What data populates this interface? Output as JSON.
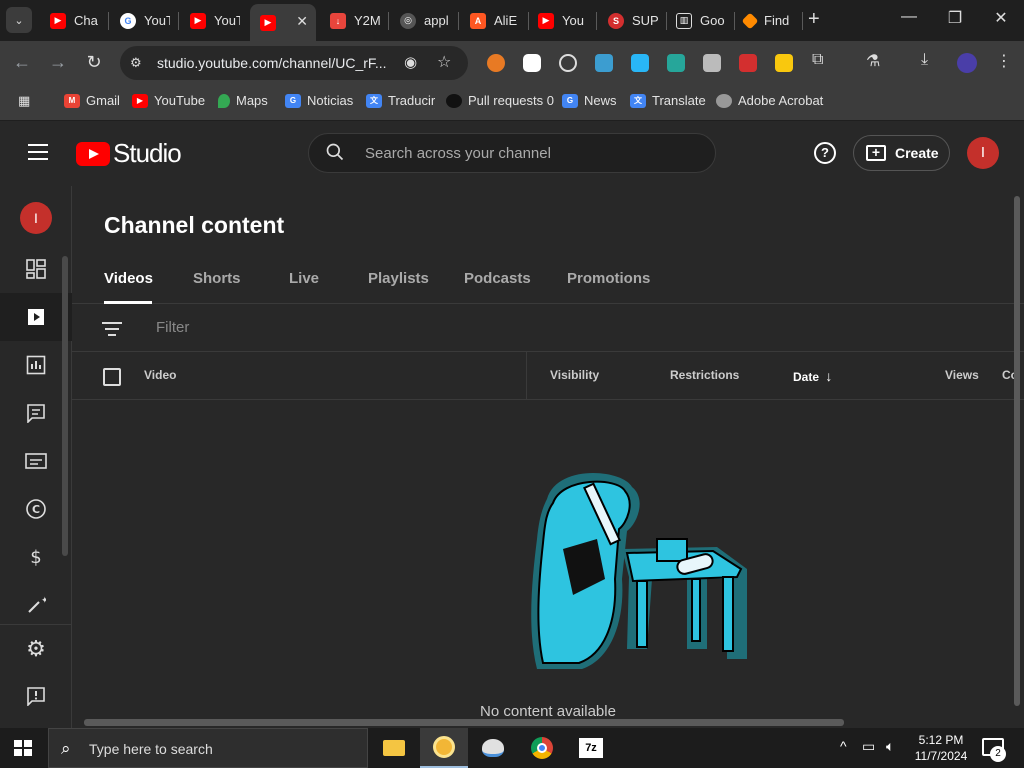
{
  "browser": {
    "tabs": [
      {
        "title": "Cha",
        "color": "#ff0000",
        "icon": "youtube-icon"
      },
      {
        "title": "YouT",
        "color": "#4285f4",
        "icon": "google-icon"
      },
      {
        "title": "YouT",
        "color": "#ff0000",
        "icon": "youtube-icon"
      },
      {
        "title": "",
        "color": "#ff0000",
        "icon": "youtube-studio-icon"
      },
      {
        "title": "Y2M",
        "color": "#e8453c",
        "icon": "download-icon"
      },
      {
        "title": "appl",
        "color": "#888888",
        "icon": "globe-icon"
      },
      {
        "title": "AliE",
        "color": "#ff5722",
        "icon": "aliexpress-icon"
      },
      {
        "title": "You",
        "color": "#ff0000",
        "icon": "youtube-icon"
      },
      {
        "title": "SUP",
        "color": "#d32f2f",
        "icon": "sup-icon"
      },
      {
        "title": "Goo",
        "color": "#dddddd",
        "icon": "google-docs-icon"
      },
      {
        "title": "Find",
        "color": "#ff8a00",
        "icon": "find-icon"
      }
    ],
    "new_tab": "+",
    "url": "studio.youtube.com/channel/UC_rF...",
    "bookmarks": [
      {
        "label": "Gmail",
        "color": "#ea4335"
      },
      {
        "label": "YouTube",
        "color": "#ff0000"
      },
      {
        "label": "Maps",
        "color": "#34a853"
      },
      {
        "label": "Noticias",
        "color": "#4285f4"
      },
      {
        "label": "Traducir",
        "color": "#4285f4"
      },
      {
        "label": "Pull requests 0",
        "color": "#333333"
      },
      {
        "label": "News",
        "color": "#4285f4"
      },
      {
        "label": "Translate",
        "color": "#4285f4"
      },
      {
        "label": "Adobe Acrobat",
        "color": "#888888"
      }
    ]
  },
  "studio": {
    "logo_text": "Studio",
    "search_placeholder": "Search across your channel",
    "create_label": "Create",
    "avatar_letter": "I",
    "help_glyph": "?"
  },
  "content": {
    "page_title": "Channel content",
    "tabs": [
      "Videos",
      "Shorts",
      "Live",
      "Playlists",
      "Podcasts",
      "Promotions"
    ],
    "filter_placeholder": "Filter",
    "columns": {
      "video": "Video",
      "visibility": "Visibility",
      "restrictions": "Restrictions",
      "date": "Date",
      "date_sort": "↓",
      "views": "Views",
      "comments": "Co"
    },
    "empty_text": "No content available"
  },
  "taskbar": {
    "search_text": "Type here to search",
    "time": "5:12 PM",
    "date": "11/7/2024",
    "notifications": "2"
  }
}
